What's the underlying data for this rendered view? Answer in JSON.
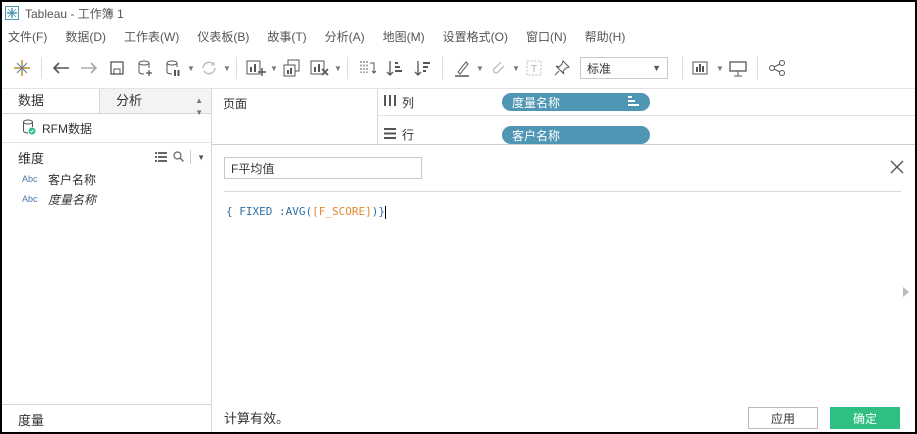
{
  "window": {
    "title": "Tableau - 工作簿 1",
    "app_icon": "tableau-logo-icon"
  },
  "menu": [
    "文件(F)",
    "数据(D)",
    "工作表(W)",
    "仪表板(B)",
    "故事(T)",
    "分析(A)",
    "地图(M)",
    "设置格式(O)",
    "窗口(N)",
    "帮助(H)"
  ],
  "toolbar": {
    "fit_value": "标准",
    "icons": [
      "tableau-home-icon",
      "back-icon",
      "forward-icon",
      "save-icon",
      "new-datasource-icon",
      "pause-update-icon",
      "refresh-icon",
      "new-worksheet-icon",
      "duplicate-icon",
      "clear-sheet-icon",
      "swap-icon",
      "sort-asc-icon",
      "sort-desc-icon",
      "highlight-icon",
      "group-icon",
      "label-icon",
      "pin-icon",
      "show-me-icon",
      "presentation-icon",
      "share-icon"
    ]
  },
  "left_pane": {
    "tab_data": "数据",
    "tab_analysis": "分析",
    "datasource": "RFM数据",
    "dimensions_label": "维度",
    "dimensions": [
      {
        "type": "Abc",
        "name": "客户名称"
      },
      {
        "type": "Abc",
        "name": "度量名称"
      }
    ],
    "measures_label": "度量"
  },
  "pages": {
    "label": "页面"
  },
  "shelves": {
    "columns": {
      "label": "列",
      "pill": "度量名称"
    },
    "rows": {
      "label": "行",
      "pill": "客户名称"
    }
  },
  "calc": {
    "name": "F平均值",
    "formula_prefix": "{ FIXED :AVG(",
    "formula_field": "[F_SCORE]",
    "formula_suffix": ")}",
    "status": "计算有效。",
    "apply_label": "应用",
    "ok_label": "确定"
  },
  "colors": {
    "pill": "#4e96b4",
    "ok_button": "#2fbf83",
    "formula": "#2f6fa3",
    "field": "#e08a2e"
  }
}
